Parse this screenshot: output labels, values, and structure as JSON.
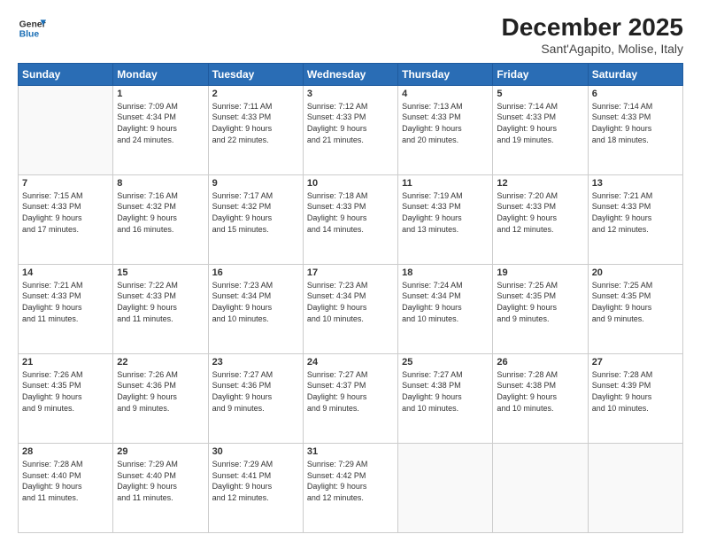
{
  "logo": {
    "line1": "General",
    "line2": "Blue"
  },
  "title": "December 2025",
  "subtitle": "Sant'Agapito, Molise, Italy",
  "weekdays": [
    "Sunday",
    "Monday",
    "Tuesday",
    "Wednesday",
    "Thursday",
    "Friday",
    "Saturday"
  ],
  "weeks": [
    [
      {
        "day": "",
        "info": ""
      },
      {
        "day": "1",
        "info": "Sunrise: 7:09 AM\nSunset: 4:34 PM\nDaylight: 9 hours\nand 24 minutes."
      },
      {
        "day": "2",
        "info": "Sunrise: 7:11 AM\nSunset: 4:33 PM\nDaylight: 9 hours\nand 22 minutes."
      },
      {
        "day": "3",
        "info": "Sunrise: 7:12 AM\nSunset: 4:33 PM\nDaylight: 9 hours\nand 21 minutes."
      },
      {
        "day": "4",
        "info": "Sunrise: 7:13 AM\nSunset: 4:33 PM\nDaylight: 9 hours\nand 20 minutes."
      },
      {
        "day": "5",
        "info": "Sunrise: 7:14 AM\nSunset: 4:33 PM\nDaylight: 9 hours\nand 19 minutes."
      },
      {
        "day": "6",
        "info": "Sunrise: 7:14 AM\nSunset: 4:33 PM\nDaylight: 9 hours\nand 18 minutes."
      }
    ],
    [
      {
        "day": "7",
        "info": "Sunrise: 7:15 AM\nSunset: 4:33 PM\nDaylight: 9 hours\nand 17 minutes."
      },
      {
        "day": "8",
        "info": "Sunrise: 7:16 AM\nSunset: 4:32 PM\nDaylight: 9 hours\nand 16 minutes."
      },
      {
        "day": "9",
        "info": "Sunrise: 7:17 AM\nSunset: 4:32 PM\nDaylight: 9 hours\nand 15 minutes."
      },
      {
        "day": "10",
        "info": "Sunrise: 7:18 AM\nSunset: 4:33 PM\nDaylight: 9 hours\nand 14 minutes."
      },
      {
        "day": "11",
        "info": "Sunrise: 7:19 AM\nSunset: 4:33 PM\nDaylight: 9 hours\nand 13 minutes."
      },
      {
        "day": "12",
        "info": "Sunrise: 7:20 AM\nSunset: 4:33 PM\nDaylight: 9 hours\nand 12 minutes."
      },
      {
        "day": "13",
        "info": "Sunrise: 7:21 AM\nSunset: 4:33 PM\nDaylight: 9 hours\nand 12 minutes."
      }
    ],
    [
      {
        "day": "14",
        "info": "Sunrise: 7:21 AM\nSunset: 4:33 PM\nDaylight: 9 hours\nand 11 minutes."
      },
      {
        "day": "15",
        "info": "Sunrise: 7:22 AM\nSunset: 4:33 PM\nDaylight: 9 hours\nand 11 minutes."
      },
      {
        "day": "16",
        "info": "Sunrise: 7:23 AM\nSunset: 4:34 PM\nDaylight: 9 hours\nand 10 minutes."
      },
      {
        "day": "17",
        "info": "Sunrise: 7:23 AM\nSunset: 4:34 PM\nDaylight: 9 hours\nand 10 minutes."
      },
      {
        "day": "18",
        "info": "Sunrise: 7:24 AM\nSunset: 4:34 PM\nDaylight: 9 hours\nand 10 minutes."
      },
      {
        "day": "19",
        "info": "Sunrise: 7:25 AM\nSunset: 4:35 PM\nDaylight: 9 hours\nand 9 minutes."
      },
      {
        "day": "20",
        "info": "Sunrise: 7:25 AM\nSunset: 4:35 PM\nDaylight: 9 hours\nand 9 minutes."
      }
    ],
    [
      {
        "day": "21",
        "info": "Sunrise: 7:26 AM\nSunset: 4:35 PM\nDaylight: 9 hours\nand 9 minutes."
      },
      {
        "day": "22",
        "info": "Sunrise: 7:26 AM\nSunset: 4:36 PM\nDaylight: 9 hours\nand 9 minutes."
      },
      {
        "day": "23",
        "info": "Sunrise: 7:27 AM\nSunset: 4:36 PM\nDaylight: 9 hours\nand 9 minutes."
      },
      {
        "day": "24",
        "info": "Sunrise: 7:27 AM\nSunset: 4:37 PM\nDaylight: 9 hours\nand 9 minutes."
      },
      {
        "day": "25",
        "info": "Sunrise: 7:27 AM\nSunset: 4:38 PM\nDaylight: 9 hours\nand 10 minutes."
      },
      {
        "day": "26",
        "info": "Sunrise: 7:28 AM\nSunset: 4:38 PM\nDaylight: 9 hours\nand 10 minutes."
      },
      {
        "day": "27",
        "info": "Sunrise: 7:28 AM\nSunset: 4:39 PM\nDaylight: 9 hours\nand 10 minutes."
      }
    ],
    [
      {
        "day": "28",
        "info": "Sunrise: 7:28 AM\nSunset: 4:40 PM\nDaylight: 9 hours\nand 11 minutes."
      },
      {
        "day": "29",
        "info": "Sunrise: 7:29 AM\nSunset: 4:40 PM\nDaylight: 9 hours\nand 11 minutes."
      },
      {
        "day": "30",
        "info": "Sunrise: 7:29 AM\nSunset: 4:41 PM\nDaylight: 9 hours\nand 12 minutes."
      },
      {
        "day": "31",
        "info": "Sunrise: 7:29 AM\nSunset: 4:42 PM\nDaylight: 9 hours\nand 12 minutes."
      },
      {
        "day": "",
        "info": ""
      },
      {
        "day": "",
        "info": ""
      },
      {
        "day": "",
        "info": ""
      }
    ]
  ]
}
